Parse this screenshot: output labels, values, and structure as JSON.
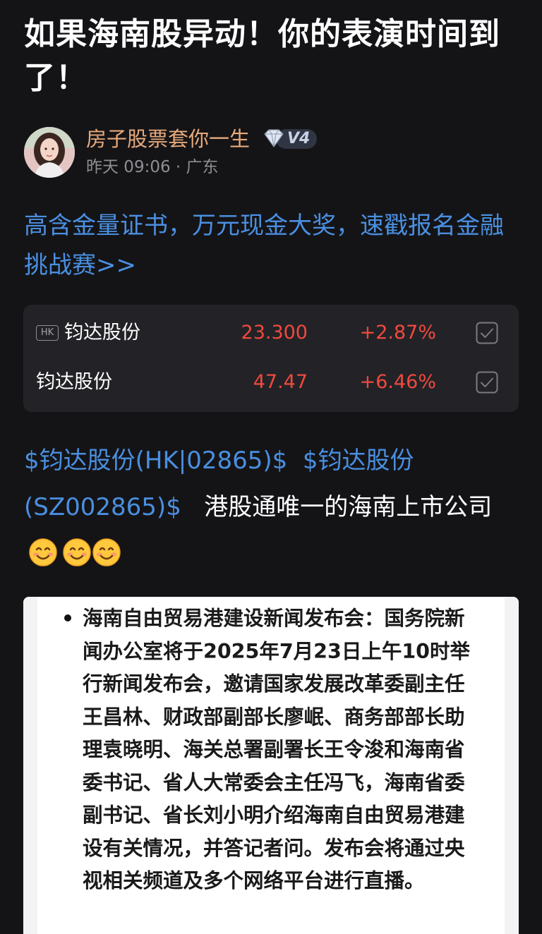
{
  "post": {
    "title": "如果海南股异动！你的表演时间到了！"
  },
  "author": {
    "name": "房子股票套你一生",
    "level": "V4",
    "meta": "昨天 09:06 · 广东"
  },
  "promo": {
    "text": "高含金量证书，万元现金大奖，速戳报名金融挑战赛>>"
  },
  "stocks": [
    {
      "market_tag": "HK",
      "name": "钧达股份",
      "price": "23.300",
      "change": "+2.87%"
    },
    {
      "market_tag": "",
      "name": "钧达股份",
      "price": "47.47",
      "change": "+6.46%"
    }
  ],
  "body": {
    "link1": "$钧达股份(HK|02865)$",
    "link2": "$钧达股份(SZ002865)$",
    "text": "港股通唯一的海南上市公司"
  },
  "news": {
    "heading": "海南自由贸易港建设新闻发布会",
    "text": "：国务院新闻办公室将于2025年7月23日上午10时举行新闻发布会，邀请国家发展改革委副主任王昌林、财政部副部长廖岷、商务部部长助理袁晓明、海关总署副署长王令浚和海南省委书记、省人大常委会主任冯飞，海南省委副书记、省长刘小明介绍海南自由贸易港建设有关情况，并答记者问。发布会将通过央视相关频道及多个网络平台进行直播。"
  },
  "colors": {
    "background": "#141417",
    "author": "#e8a97a",
    "link": "#4a8fe0",
    "up": "#f0493e",
    "card": "#232327"
  },
  "icons": {
    "level_badge": "diamond-icon",
    "check": "check-square-icon",
    "emoji": "smiling-face-icon"
  }
}
